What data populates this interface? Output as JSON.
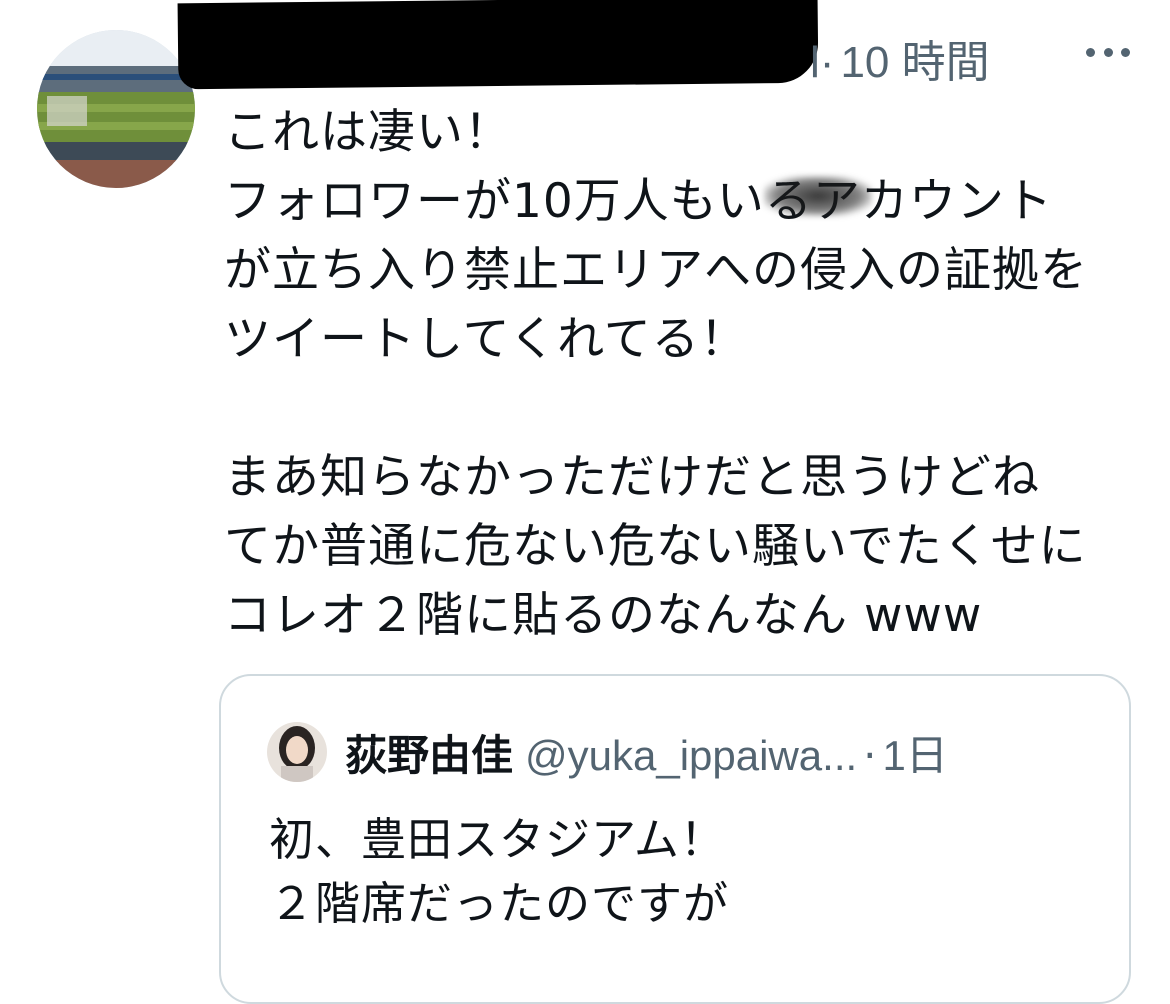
{
  "tweet": {
    "timestamp": "10 時間",
    "separator": "l·",
    "text": "これは凄い！\nフォロワーが10万人もいるアカウント\nが立ち入り禁止エリアへの侵入の証拠を\nツイートしてくれてる！\n\nまあ知らなかっただけだと思うけどね\nてか普通に危ない危ない騒いでたくせに\nコレオ２階に貼るのなんなん www"
  },
  "quote": {
    "name": "荻野由佳",
    "handle": "@yuka_ippaiwa...",
    "dot": "·",
    "time": "1日",
    "text": "初、豊田スタジアム！\n２階席だったのですが"
  },
  "colors": {
    "text": "#0f1419",
    "secondary": "#536471",
    "border": "#cfd9de"
  },
  "icons": {
    "more": "more-horizontal-icon"
  }
}
